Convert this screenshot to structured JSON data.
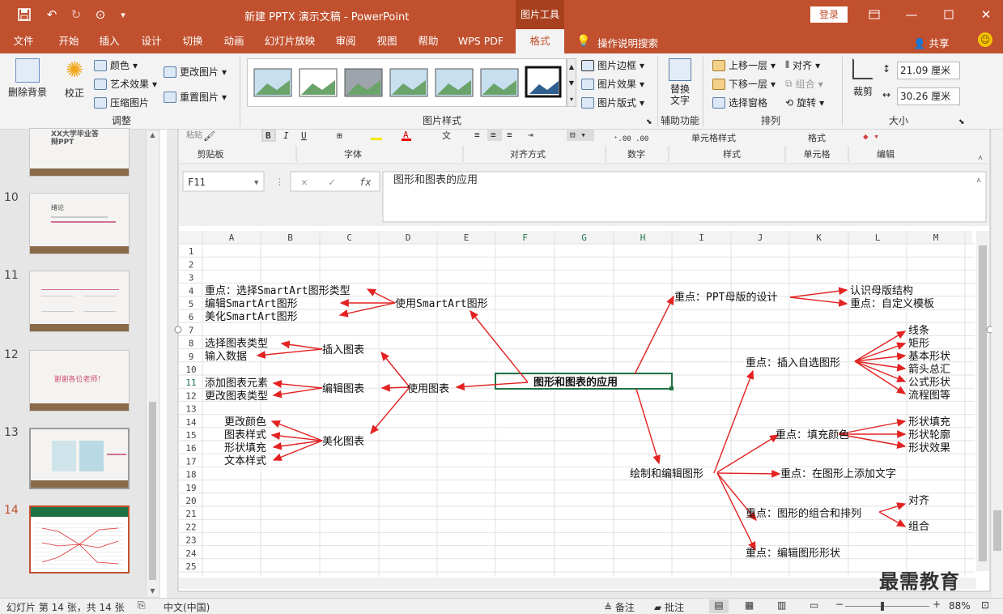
{
  "title_bar": {
    "title": "新建 PPTX 演示文稿 - PowerPoint",
    "context_tab": "图片工具",
    "login_label": "登录"
  },
  "tabs": [
    "文件",
    "开始",
    "插入",
    "设计",
    "切换",
    "动画",
    "幻灯片放映",
    "审阅",
    "视图",
    "帮助",
    "WPS PDF",
    "格式"
  ],
  "tell_me": "操作说明搜索",
  "share": "共享",
  "ribbon": {
    "adjust": {
      "remove_bg": "删除背景",
      "correct": "校正",
      "color": "颜色",
      "art": "艺术效果",
      "compress": "压缩图片",
      "change": "更改图片",
      "reset": "重置图片",
      "group": "调整"
    },
    "styles": {
      "group": "图片样式",
      "border": "图片边框",
      "effect": "图片效果",
      "layout": "图片版式"
    },
    "aux": {
      "alt_text": "替换文字",
      "group": "辅助功能"
    },
    "arrange": {
      "forward": "上移一层",
      "backward": "下移一层",
      "pane": "选择窗格",
      "align": "对齐",
      "group_btn": "组合",
      "rotate": "旋转",
      "group": "排列"
    },
    "size": {
      "crop": "裁剪",
      "height": "21.09 厘米",
      "width": "30.26 厘米",
      "group": "大小"
    }
  },
  "thumbnails": [
    {
      "num": "",
      "title": "XX大学毕业答辩PPT"
    },
    {
      "num": "10",
      "title": "绪论"
    },
    {
      "num": "11",
      "title": ""
    },
    {
      "num": "12",
      "title": "谢谢各位老师！"
    },
    {
      "num": "13",
      "title": ""
    },
    {
      "num": "14",
      "title": ""
    }
  ],
  "excel": {
    "ribbon_groups": [
      "剪贴板",
      "字体",
      "对齐方式",
      "数字",
      "样式",
      "单元格",
      "编辑"
    ],
    "ribbon_items": {
      "cond": "单元格样式",
      "format": "格式"
    },
    "name_box": "F11",
    "formula": "图形和图表的应用",
    "columns": [
      "A",
      "B",
      "C",
      "D",
      "E",
      "F",
      "G",
      "H",
      "I",
      "J",
      "K",
      "L",
      "M"
    ],
    "rows": [
      "1",
      "2",
      "3",
      "4",
      "5",
      "6",
      "7",
      "8",
      "9",
      "10",
      "11",
      "12",
      "13",
      "14",
      "15",
      "16",
      "17",
      "18",
      "19",
      "20",
      "21",
      "22",
      "23",
      "24",
      "25"
    ],
    "nodes": {
      "center": "图形和图表的应用",
      "smartart": "使用SmartArt图形",
      "sa1": "重点：选择SmartArt图形类型",
      "sa2": "编辑SmartArt图形",
      "sa3": "美化SmartArt图形",
      "chart": "使用图表",
      "insert_chart": "插入图表",
      "ic1": "选择图表类型",
      "ic2": "输入数据",
      "edit_chart": "编辑图表",
      "ec1": "添加图表元素",
      "ec2": "更改图表类型",
      "beautify": "美化图表",
      "b1": "更改颜色",
      "b2": "图表样式",
      "b3": "形状填充",
      "b4": "文本样式",
      "master": "重点：PPT母版的设计",
      "m1": "认识母版结构",
      "m2": "重点：自定义模板",
      "draw": "绘制和编辑图形",
      "shape": "重点：插入自选图形",
      "s1": "线条",
      "s2": "矩形",
      "s3": "基本形状",
      "s4": "箭头总汇",
      "s5": "公式形状",
      "s6": "流程图等",
      "fill": "重点：填充颜色",
      "f1": "形状填充",
      "f2": "形状轮廓",
      "f3": "形状效果",
      "text": "重点：在图形上添加文字",
      "group": "重点：图形的组合和排列",
      "g1": "对齐",
      "g2": "组合",
      "edit_shape": "重点：编辑图形形状"
    }
  },
  "status": {
    "slide_info": "幻灯片 第 14 张，共 14 张",
    "language": "中文(中国)",
    "notes": "备注",
    "comments": "批注",
    "zoom": "88%"
  },
  "watermark": "最需教育"
}
